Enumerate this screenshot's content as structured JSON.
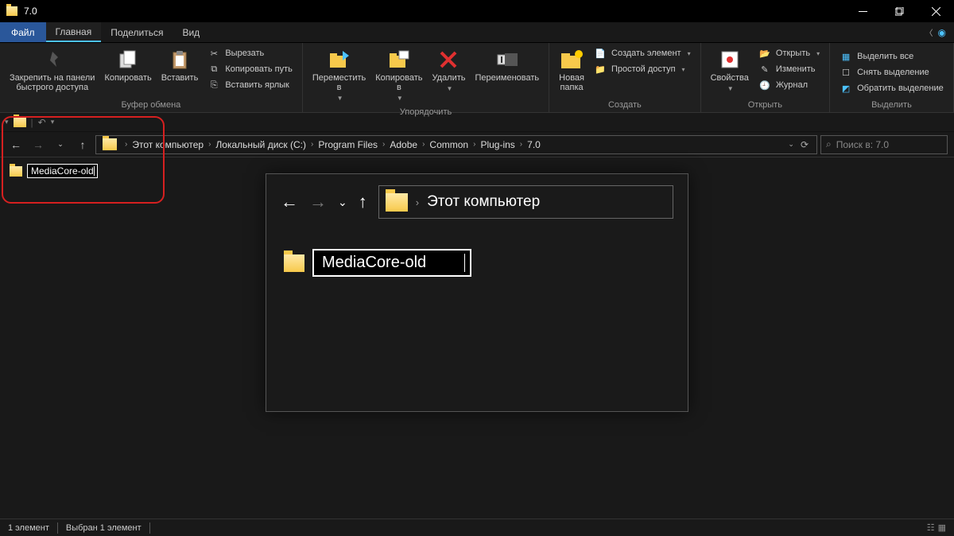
{
  "title": "7.0",
  "menu": {
    "file": "Файл",
    "tabs": [
      "Главная",
      "Поделиться",
      "Вид"
    ]
  },
  "ribbon": {
    "clipboard": {
      "pin": "Закрепить на панели\nбыстрого доступа",
      "copy": "Копировать",
      "paste": "Вставить",
      "cut": "Вырезать",
      "copypath": "Копировать путь",
      "shortcut": "Вставить ярлык",
      "label": "Буфер обмена"
    },
    "organize": {
      "move": "Переместить\nв ",
      "copyto": "Копировать\nв ",
      "delete": "Удалить",
      "rename": "Переименовать",
      "label": "Упорядочить"
    },
    "new": {
      "folder": "Новая\nпапка",
      "item": "Создать элемент",
      "access": "Простой доступ",
      "label": "Создать"
    },
    "open": {
      "props": "Свойства",
      "open": "Открыть",
      "edit": "Изменить",
      "history": "Журнал",
      "label": "Открыть"
    },
    "select": {
      "all": "Выделить все",
      "none": "Снять выделение",
      "invert": "Обратить выделение",
      "label": "Выделить"
    }
  },
  "breadcrumb": [
    "Этот компьютер",
    "Локальный диск (C:)",
    "Program Files",
    "Adobe",
    "Common",
    "Plug-ins",
    "7.0"
  ],
  "search_placeholder": "Поиск в: 7.0",
  "folder_name": "MediaCore-old",
  "zoom": {
    "crumb": "Этот компьютер",
    "folder": "MediaCore-old"
  },
  "status": {
    "count": "1 элемент",
    "selected": "Выбран 1 элемент"
  }
}
